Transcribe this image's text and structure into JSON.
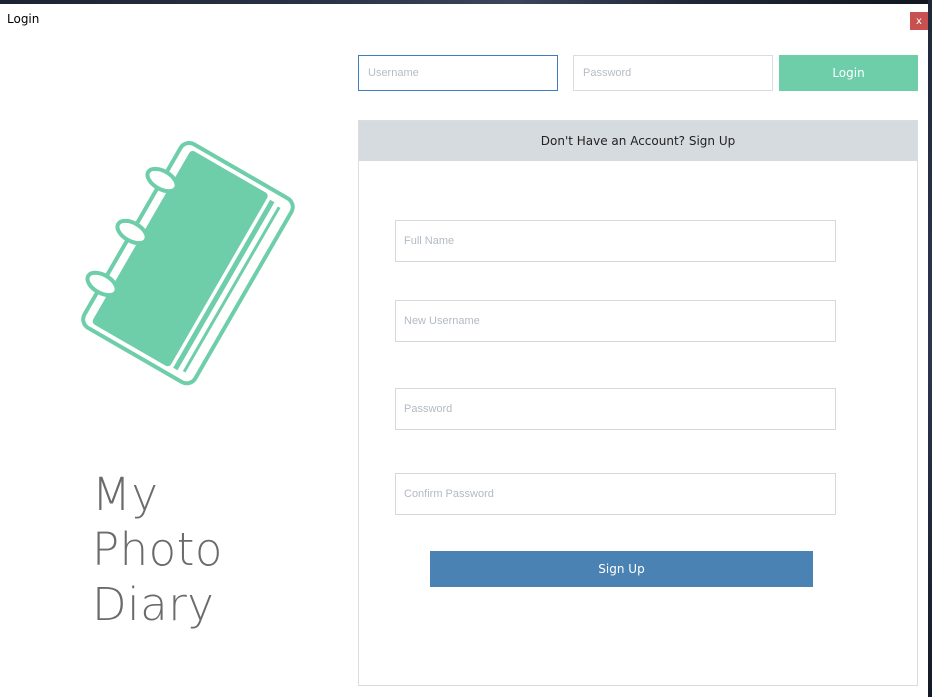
{
  "window": {
    "title": "Login",
    "close_label": "x"
  },
  "brand": {
    "line1": "My",
    "line2": "Photo",
    "line3": "Diary",
    "accent_color": "#6dcea9"
  },
  "login": {
    "username_placeholder": "Username",
    "password_placeholder": "Password",
    "login_label": "Login"
  },
  "signup": {
    "header": "Don't Have an Account? Sign Up",
    "full_name_placeholder": "Full Name",
    "new_username_placeholder": "New Username",
    "password_placeholder": "Password",
    "confirm_password_placeholder": "Confirm Password",
    "signup_label": "Sign Up",
    "button_color": "#4a82b4"
  },
  "icons": {
    "logo": "notebook-icon"
  }
}
